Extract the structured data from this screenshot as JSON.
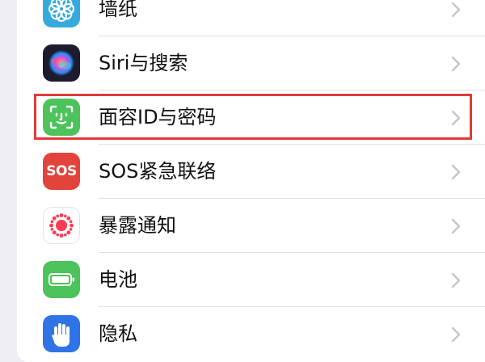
{
  "settings": {
    "rows": [
      {
        "label": "墙纸",
        "icon": "wallpaper-flower-icon",
        "icon_color": "#36aadc"
      },
      {
        "label": "Siri与搜索",
        "icon": "siri-icon",
        "icon_color": "#1c1c2e"
      },
      {
        "label": "面容ID与密码",
        "icon": "face-id-icon",
        "icon_color": "#4cc35b"
      },
      {
        "label": "SOS紧急联络",
        "icon": "sos-icon",
        "icon_color": "#e2433a",
        "icon_text": "SOS"
      },
      {
        "label": "暴露通知",
        "icon": "exposure-notification-icon",
        "icon_color": "#ffffff"
      },
      {
        "label": "电池",
        "icon": "battery-icon",
        "icon_color": "#4cc35b"
      },
      {
        "label": "隐私",
        "icon": "privacy-hand-icon",
        "icon_color": "#2f74e6"
      }
    ],
    "highlighted_row": "面容ID与密码",
    "highlight_color": "#e23b39",
    "chevron_icon": "chevron-right-icon"
  }
}
